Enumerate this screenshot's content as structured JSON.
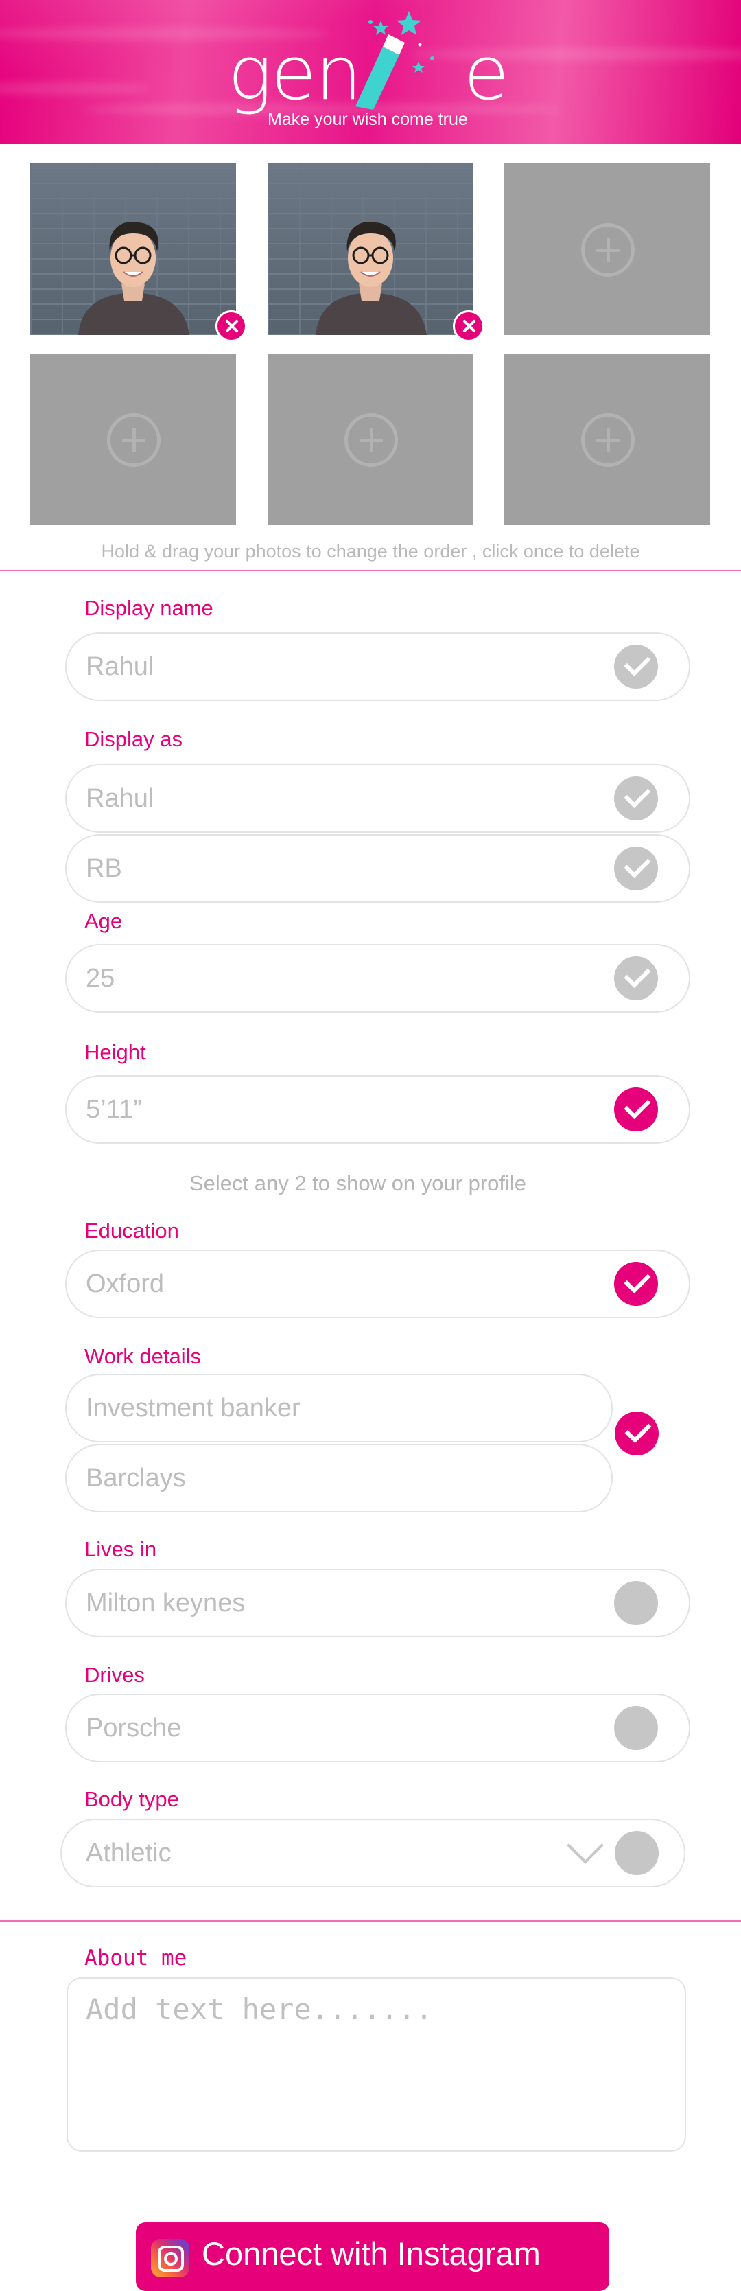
{
  "brand": {
    "logo_text_left": "gen",
    "logo_text_right": "e",
    "tagline": "Make your wish come true",
    "accent_color": "#e6007a",
    "wand_color": "#3fd3cf"
  },
  "photos": {
    "slots": [
      {
        "state": "filled",
        "icon": "delete-icon"
      },
      {
        "state": "filled",
        "icon": "delete-icon"
      },
      {
        "state": "empty",
        "icon": "add-photo-icon"
      },
      {
        "state": "empty",
        "icon": "add-photo-icon"
      },
      {
        "state": "empty",
        "icon": "add-photo-icon"
      },
      {
        "state": "empty",
        "icon": "add-photo-icon"
      }
    ],
    "hint": "Hold & drag your photos to change the order , click once to delete"
  },
  "profile": {
    "display_name": {
      "label": "Display name",
      "value": "Rahul",
      "checked": false
    },
    "display_as": {
      "label": "Display as",
      "options": [
        {
          "value": "Rahul",
          "checked": false
        },
        {
          "value": "RB",
          "checked": false
        }
      ]
    },
    "age": {
      "label": "Age",
      "value": "25",
      "checked": false
    },
    "height": {
      "label": "Height",
      "value": "5’11”",
      "checked": true
    },
    "select_hint": "Select any 2 to show on your profile",
    "education": {
      "label": "Education",
      "value": "Oxford",
      "checked": true
    },
    "work": {
      "label": "Work details",
      "title": "Investment banker",
      "company": "Barclays",
      "checked": true
    },
    "lives_in": {
      "label": "Lives in",
      "value": "Milton keynes",
      "checked": false
    },
    "drives": {
      "label": "Drives",
      "value": "Porsche",
      "checked": false
    },
    "body_type": {
      "label": "Body type",
      "value": "Athletic",
      "checked": false
    }
  },
  "about": {
    "label": "About me",
    "placeholder": "Add text here......."
  },
  "instagram": {
    "button_label": "Connect with Instagram",
    "icon": "instagram-icon"
  }
}
